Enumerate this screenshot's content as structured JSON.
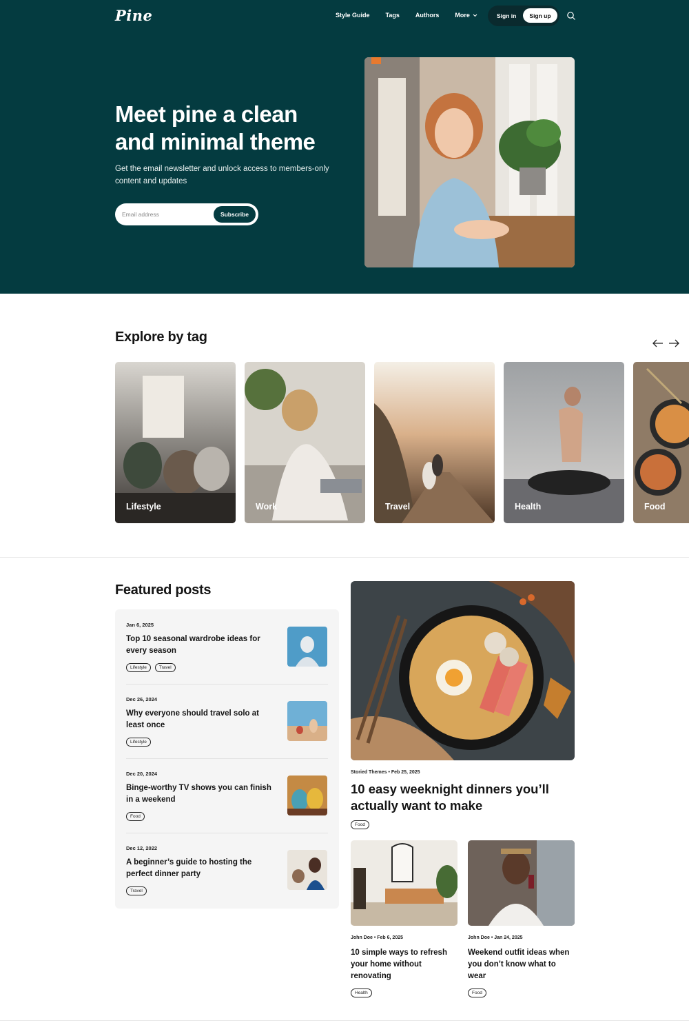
{
  "header": {
    "logo": "Pine",
    "nav": [
      {
        "label": "Style Guide"
      },
      {
        "label": "Tags"
      },
      {
        "label": "Authors"
      },
      {
        "label": "More"
      }
    ],
    "sign_in": "Sign in",
    "sign_up": "Sign up",
    "search_icon": "search-icon"
  },
  "hero": {
    "title": "Meet pine a clean and minimal theme",
    "subtitle": "Get the email newsletter and unlock access to members-only content and updates",
    "email_placeholder": "Email address",
    "subscribe": "Subscribe"
  },
  "explore": {
    "title": "Explore by tag",
    "prev_icon": "arrow-left-icon",
    "next_icon": "arrow-right-icon",
    "tags": [
      {
        "label": "Lifestyle"
      },
      {
        "label": "Work"
      },
      {
        "label": "Travel"
      },
      {
        "label": "Health"
      },
      {
        "label": "Food"
      }
    ]
  },
  "featured": {
    "title": "Featured posts",
    "list": [
      {
        "date": "Jan 6, 2025",
        "title": "Top 10 seasonal wardrobe ideas for every season",
        "tags": [
          "Lifestyle",
          "Travel"
        ]
      },
      {
        "date": "Dec 26, 2024",
        "title": "Why everyone should travel solo at least once",
        "tags": [
          "Lifestyle"
        ]
      },
      {
        "date": "Dec 20, 2024",
        "title": "Binge-worthy TV shows you can finish in a weekend",
        "tags": [
          "Food"
        ]
      },
      {
        "date": "Dec 12, 2022",
        "title": "A beginner’s guide to hosting the perfect dinner party",
        "tags": [
          "Travel"
        ]
      }
    ],
    "main": {
      "author": "Storied Themes",
      "date": "Feb 25, 2025",
      "title": "10 easy weeknight dinners you’ll actually want to make",
      "tag": "Food"
    },
    "grid": [
      {
        "author": "John Doe",
        "date": "Feb 6, 2025",
        "title": "10 simple ways to refresh your home without renovating",
        "tag": "Health"
      },
      {
        "author": "John Doe",
        "date": "Jan 24, 2025",
        "title": "Weekend outfit ideas when you don’t know what to wear",
        "tag": "Food"
      }
    ]
  },
  "colors": {
    "hero_bg": "#043b40",
    "panel_bg": "#f5f5f5",
    "text": "#151515"
  }
}
